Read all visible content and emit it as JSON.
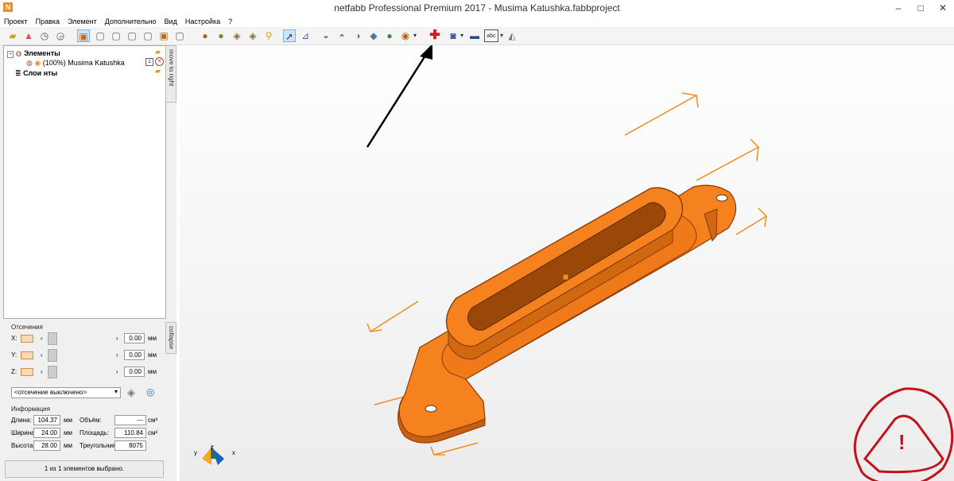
{
  "window": {
    "title": "netfabb Professional Premium 2017 - Musima Katushka.fabbproject",
    "app_icon": "N",
    "minimize": "–",
    "maximize": "□",
    "close": "✕"
  },
  "menu": [
    "Проект",
    "Правка",
    "Элемент",
    "Дополнительно",
    "Вид",
    "Настройка",
    "?"
  ],
  "tree": {
    "root_label": "Элементы",
    "part_label": "(100%) Musima Katushka",
    "layers_label": "Слои нты"
  },
  "side_tabs": {
    "move": "move to right",
    "collapse": "collapse"
  },
  "cut": {
    "title": "Отсечения",
    "x_label": "X:",
    "y_label": "Y:",
    "z_label": "Z:",
    "x_value": "0.00",
    "y_value": "0.00",
    "z_value": "0.00",
    "unit": "мм",
    "mode": "<отсечение выключено>"
  },
  "info": {
    "title": "Информация",
    "length_label": "Длина:",
    "length_value": "104.37",
    "length_unit": "мм",
    "width_label": "Ширина:",
    "width_value": "24.00",
    "width_unit": "мм",
    "height_label": "Высота:",
    "height_value": "28.00",
    "height_unit": "мм",
    "volume_label": "Объём:",
    "volume_value": "---",
    "volume_unit": "см³",
    "area_label": "Площадь:",
    "area_value": "110.84",
    "area_unit": "см²",
    "triangles_label": "Треугольники",
    "triangles_value": "8075"
  },
  "status": "1 из 1 элементов выбрано.",
  "axis": {
    "x": "x",
    "y": "y",
    "z": "z"
  },
  "warning_icon": "!",
  "colors": {
    "accent": "#f28c1e",
    "model": "#f5821f",
    "annotation_arrow": "#000000",
    "warning_mark": "#c0141c"
  }
}
